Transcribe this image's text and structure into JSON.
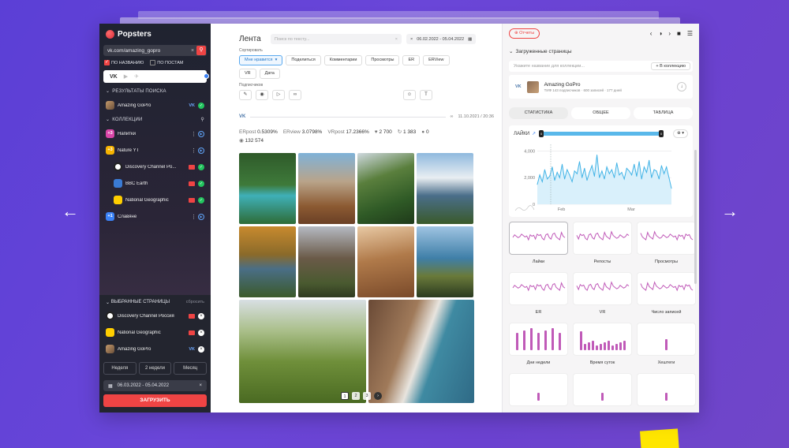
{
  "app": {
    "name": "Popsters"
  },
  "sidebar": {
    "search_value": "vk.com/amazing_gopro",
    "filter_by_name": "ПО НАЗВАНИЮ",
    "filter_by_posts": "ПО ПОСТАМ",
    "platform_vk": "VK",
    "results_header": "РЕЗУЛЬТАТЫ ПОИСКА",
    "results": [
      {
        "label": "Amazing GoPro",
        "network": "VK"
      }
    ],
    "collections_header": "КОЛЛЕКЦИИ",
    "collections": [
      {
        "badge": "+3",
        "label": "Напитки"
      },
      {
        "badge": "+3",
        "label": "Nature YT"
      },
      {
        "label": "Discovery Channel Po..."
      },
      {
        "label": "BBC Earth"
      },
      {
        "label": "National Geographic"
      },
      {
        "badge": "+1",
        "label": "Славяне"
      }
    ],
    "selected_header": "ВЫБРАННЫЕ СТРАНИЦЫ",
    "reset_label": "сбросить",
    "selected": [
      {
        "label": "Discovery Channel Россия"
      },
      {
        "label": "National Geographic"
      },
      {
        "label": "Amazing GoPro",
        "network": "VK"
      }
    ],
    "periods": [
      "Неделя",
      "2 недели",
      "Месяц"
    ],
    "date_range": "06.03.2022 - 05.04.2022",
    "load_button": "ЗАГРУЗИТЬ"
  },
  "feed": {
    "title": "Лента",
    "search_placeholder": "Поиск по тексту...",
    "date_range": "06.02.2022 - 05.04.2022",
    "sort_label": "Сортировать",
    "sort_chips": [
      "Мне нравится",
      "Поделиться",
      "Комментарии",
      "Просмотры",
      "ER",
      "ERView",
      "VR",
      "Дата"
    ],
    "subscribers_label": "Подписчиков",
    "post": {
      "network": "VK",
      "datetime": "11.10.2021 / 20:36",
      "erpost_label": "ERpost",
      "erpost": "0.5309%",
      "erview_label": "ERview",
      "erview": "3.0798%",
      "vrpost_label": "VRpost",
      "vrpost": "17.2366%",
      "likes": "2 700",
      "reposts": "1 383",
      "comments": "0",
      "views": "132 574"
    },
    "pages": [
      "1",
      "2",
      "3"
    ]
  },
  "right": {
    "reports_button": "Отчеты",
    "loaded_header": "Загруженные страницы",
    "collection_placeholder": "Укажите название для коллекции...",
    "collection_button": "+ В коллекцию",
    "page": {
      "network": "VK",
      "name": "Amazing GoPro",
      "meta": "ТИФ 143 подписчиков · 600 записей · 177 дней"
    },
    "tabs": [
      "СТАТИСТИКА",
      "ОБЩЕЕ",
      "ТАБЛИЦА"
    ],
    "chart_title": "ЛАЙКИ",
    "range_start": "0",
    "range_end": "0",
    "metrics": [
      "Лайки",
      "Репосты",
      "Просмотры",
      "ER",
      "VR",
      "Число записей",
      "Дни недели",
      "Время суток",
      "Хештеги"
    ]
  },
  "chart_data": {
    "type": "area",
    "title": "ЛАЙКИ",
    "ylim": [
      0,
      4500
    ],
    "yticks": [
      "4,000",
      "2,000",
      "0"
    ],
    "xticks": [
      "Feb",
      "Mar"
    ],
    "grid": true,
    "values": [
      1500,
      2200,
      1700,
      2600,
      1900,
      2100,
      2800,
      1800,
      2400,
      2000,
      3000,
      1900,
      2600,
      2200,
      1700,
      2500,
      2300,
      3200,
      2000,
      2700,
      1800,
      2400,
      2900,
      2100,
      3700,
      2000,
      2500,
      1900,
      2800,
      2300,
      2600,
      2000,
      3100,
      2200,
      2400,
      1900,
      2700,
      2500,
      2200,
      3000,
      2100,
      3200,
      1900,
      2800,
      2400,
      3300,
      2000,
      2600,
      2500,
      1900,
      2900,
      2300,
      2800,
      2000,
      1200
    ],
    "color": "#41b3e6"
  }
}
